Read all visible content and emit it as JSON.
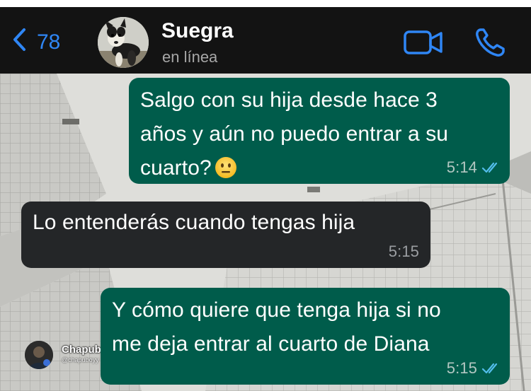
{
  "header": {
    "back_count": "78",
    "contact_name": "Suegra",
    "contact_status": "en línea",
    "icons": {
      "back": "chevron-left-icon",
      "video": "video-camera-icon",
      "call": "phone-icon"
    },
    "accent_color": "#2f86f5"
  },
  "messages": [
    {
      "direction": "outgoing",
      "lines": [
        "Salgo con su hija desde hace 3",
        "años y aún no puedo entrar a su",
        "cuarto?"
      ],
      "emoji": "neutral-face-emoji",
      "time": "5:14",
      "read_receipt": "double-check-read-icon"
    },
    {
      "direction": "incoming",
      "lines": [
        "Lo entenderás cuando tengas hija"
      ],
      "time": "5:15"
    },
    {
      "direction": "outgoing",
      "lines": [
        "Y cómo quiere que tenga hija si no",
        "me deja entrar al cuarto de Diana"
      ],
      "time": "5:15",
      "read_receipt": "double-check-read-icon"
    }
  ],
  "watermark": {
    "name": "Chapuboyy",
    "handle": "@chapuboyy"
  },
  "colors": {
    "outgoing_bubble": "#005c4b",
    "incoming_bubble": "#242628",
    "header_bg": "#131313"
  }
}
